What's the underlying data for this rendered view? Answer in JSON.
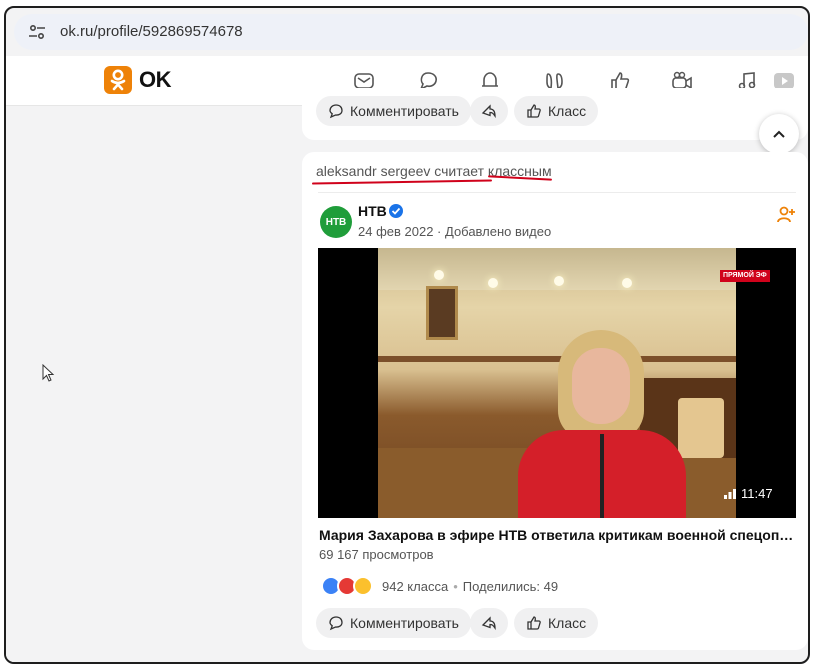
{
  "browser": {
    "url": "ok.ru/profile/592869574678",
    "site_info_icon": "tune-icon"
  },
  "header": {
    "logo_text": "OK",
    "brand_color": "#ee8208",
    "nav_icons": [
      "mail-icon",
      "chat-icon",
      "bell-icon",
      "guests-icon",
      "like-icon",
      "video-icon",
      "music-icon",
      "play-icon"
    ]
  },
  "prev_post": {
    "comment_label": "Комментировать",
    "share_icon": "share-icon",
    "klass_label": "Класс"
  },
  "post": {
    "liked_by": "aleksandr sergeev считает классным",
    "highlight_color": "#d0021b",
    "author": "НТВ",
    "author_avatar_text": "НТВ",
    "date_meta": "24 фев 2022 · Добавлено видео",
    "video": {
      "duration": "11:47",
      "live_badge": "ПРЯМОЙ ЭФ"
    },
    "title": "Мария Захарова в эфире НТВ ответила критикам военной спецоперац…",
    "views": "69 167 просмотров",
    "reactions_count": "942 класса",
    "shares": "Поделились: 49",
    "comment_label": "Комментировать",
    "klass_label": "Класс"
  }
}
